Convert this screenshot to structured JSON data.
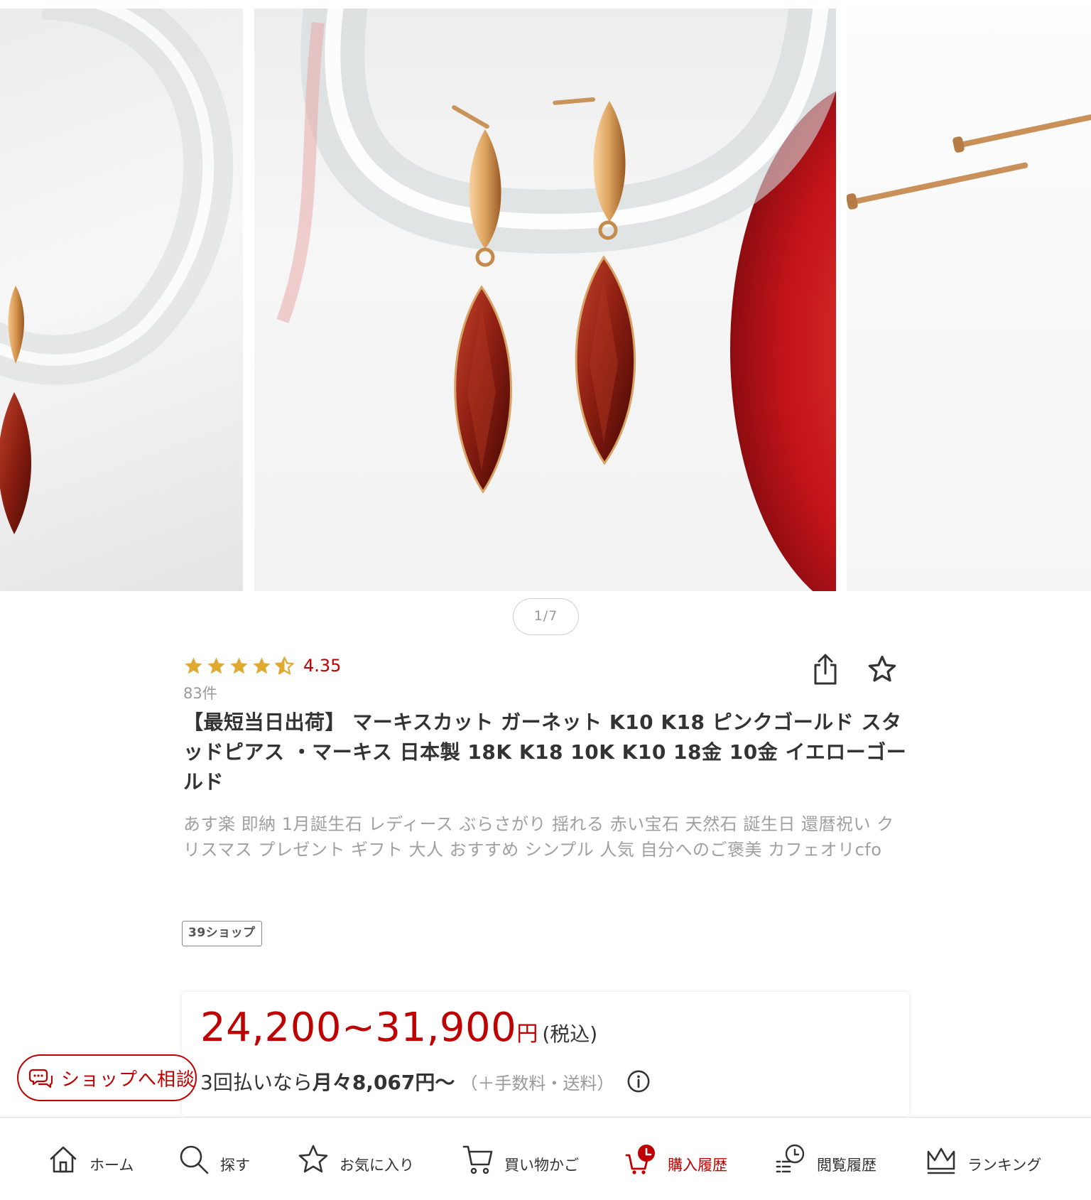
{
  "carousel": {
    "pager": "1/7"
  },
  "product": {
    "rating_value": "4.35",
    "rating_stars": 4.35,
    "review_count": "83件",
    "title": "【最短当日出荷】 マーキスカット ガーネット K10 K18 ピンクゴールド スタッドピアス ・マーキス 日本製 18K K18 10K K10 18金 10金 イエローゴールド",
    "catch_copy": "あす楽 即納 1月誕生石 レディース ぶらさがり 揺れる 赤い宝石 天然石 誕生日 還暦祝い クリスマス プレゼント ギフト 大人 おすすめ シンプル 人気 自分へのご褒美 カフェオリcfo",
    "shop_badge": "39ショップ",
    "icons": {
      "share": "share-icon",
      "favorite": "star-outline-icon"
    }
  },
  "price": {
    "range": "24,200~31,900",
    "yen": "円",
    "tax": "(税込)",
    "installment_prefix": "3回払いなら",
    "installment_amount": "月々8,067円〜",
    "installment_fee": "（＋手数料・送料）"
  },
  "consult": {
    "label": "ショップへ相談"
  },
  "bottom_nav": {
    "active_color": "#bf0000",
    "items": [
      {
        "label": "ホーム",
        "icon": "home-icon"
      },
      {
        "label": "探す",
        "icon": "search-icon"
      },
      {
        "label": "お気に入り",
        "icon": "star-icon"
      },
      {
        "label": "買い物かご",
        "icon": "cart-icon"
      },
      {
        "label": "購入履歴",
        "icon": "purchase-history-icon",
        "active": true
      },
      {
        "label": "閲覧履歴",
        "icon": "browsing-history-icon"
      },
      {
        "label": "ランキング",
        "icon": "crown-icon"
      }
    ]
  },
  "colors": {
    "accent": "#bf0000",
    "star": "#e0a930",
    "gold": "#d39a5a",
    "garnet": "#8e1f12"
  }
}
